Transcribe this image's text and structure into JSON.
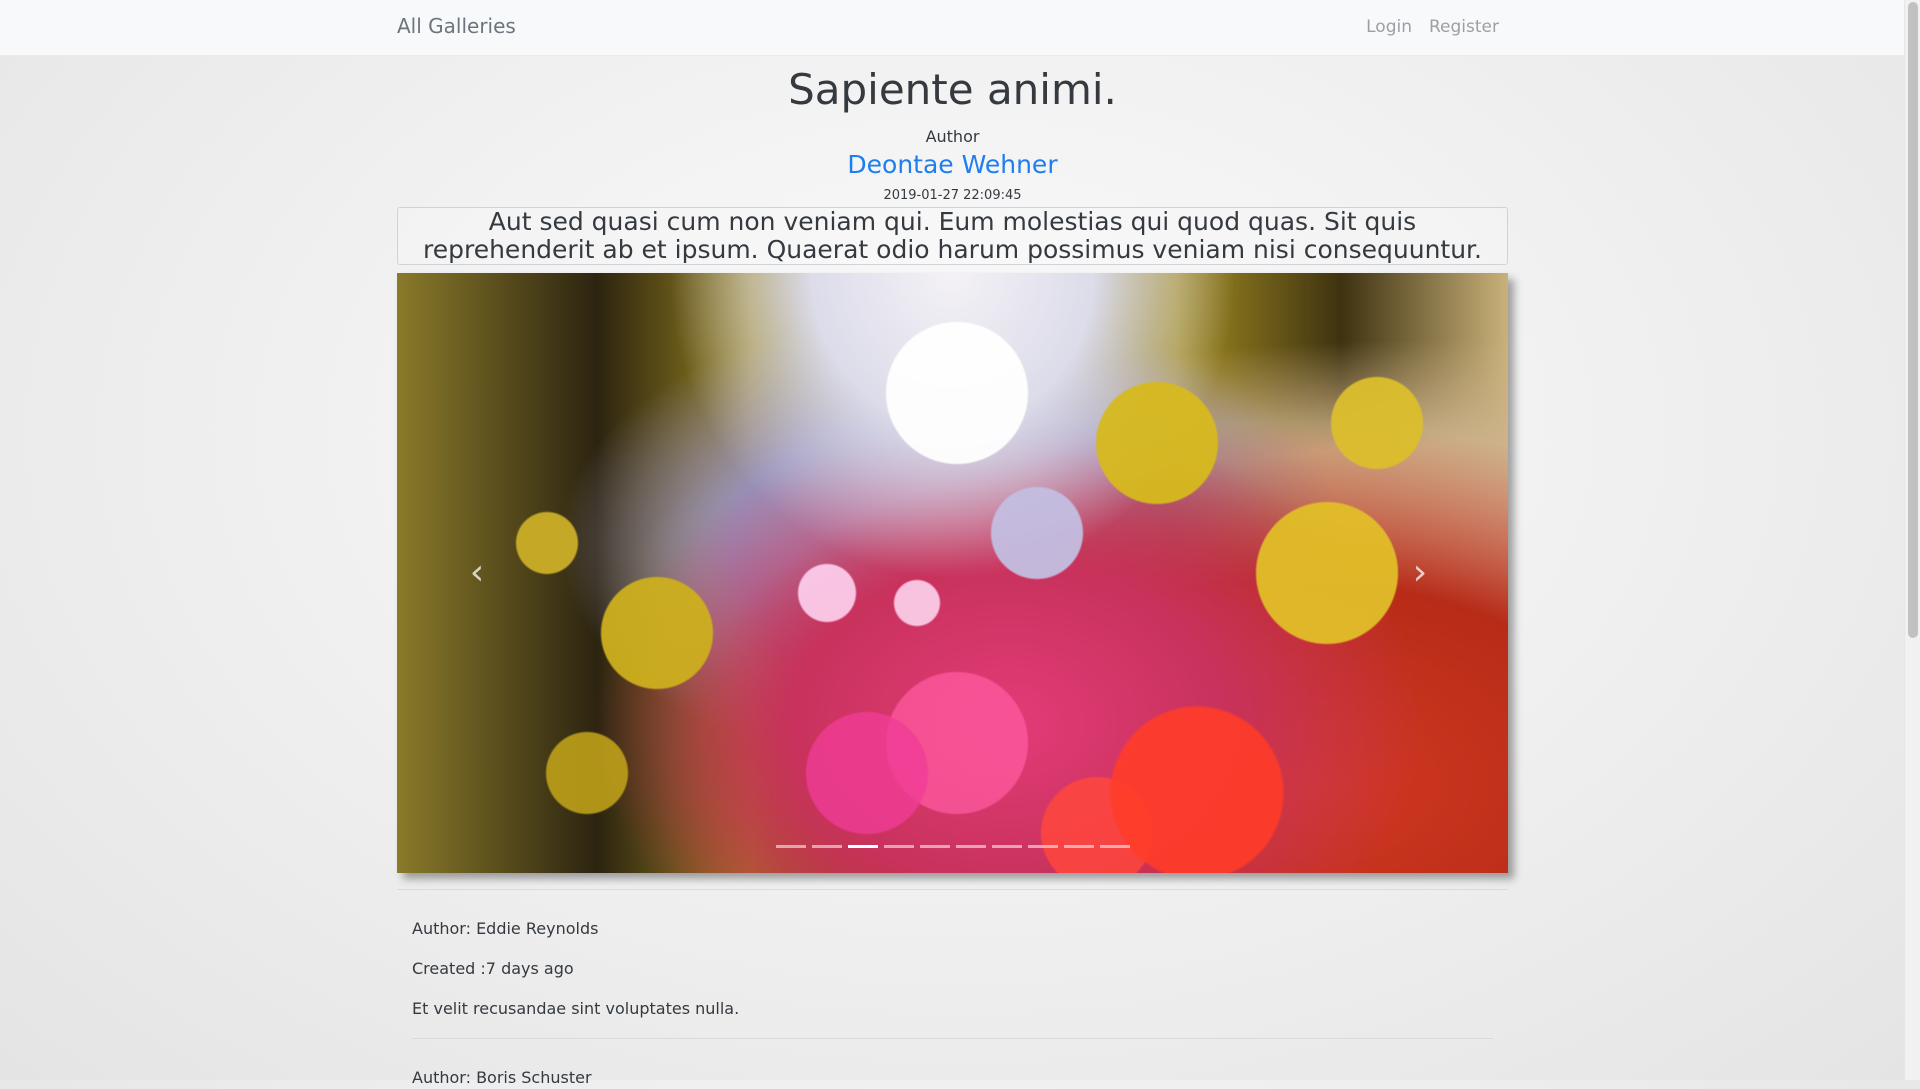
{
  "navbar": {
    "brand": "All Galleries",
    "login": "Login",
    "register": "Register"
  },
  "gallery": {
    "title": "Sapiente animi.",
    "author_label": "Author",
    "author_name": "Deontae Wehner",
    "date": "2019-01-27 22:09:45",
    "description": "Aut sed quasi cum non veniam qui. Eum molestias qui quod quas. Sit quis reprehenderit ab et ipsum. Quaerat odio harum possimus veniam nisi consequuntur."
  },
  "carousel": {
    "prev_icon": "chevron-left-icon",
    "next_icon": "chevron-right-icon",
    "indicator_count": 10,
    "active_index": 2
  },
  "comments": [
    {
      "author": "Author: Eddie Reynolds",
      "created": "Created :7 days ago",
      "text": "Et velit recusandae sint voluptates nulla."
    },
    {
      "author": "Author: Boris Schuster"
    }
  ],
  "colors": {
    "link": "#1e7ef0",
    "navbar_bg": "#f8f9fa"
  }
}
